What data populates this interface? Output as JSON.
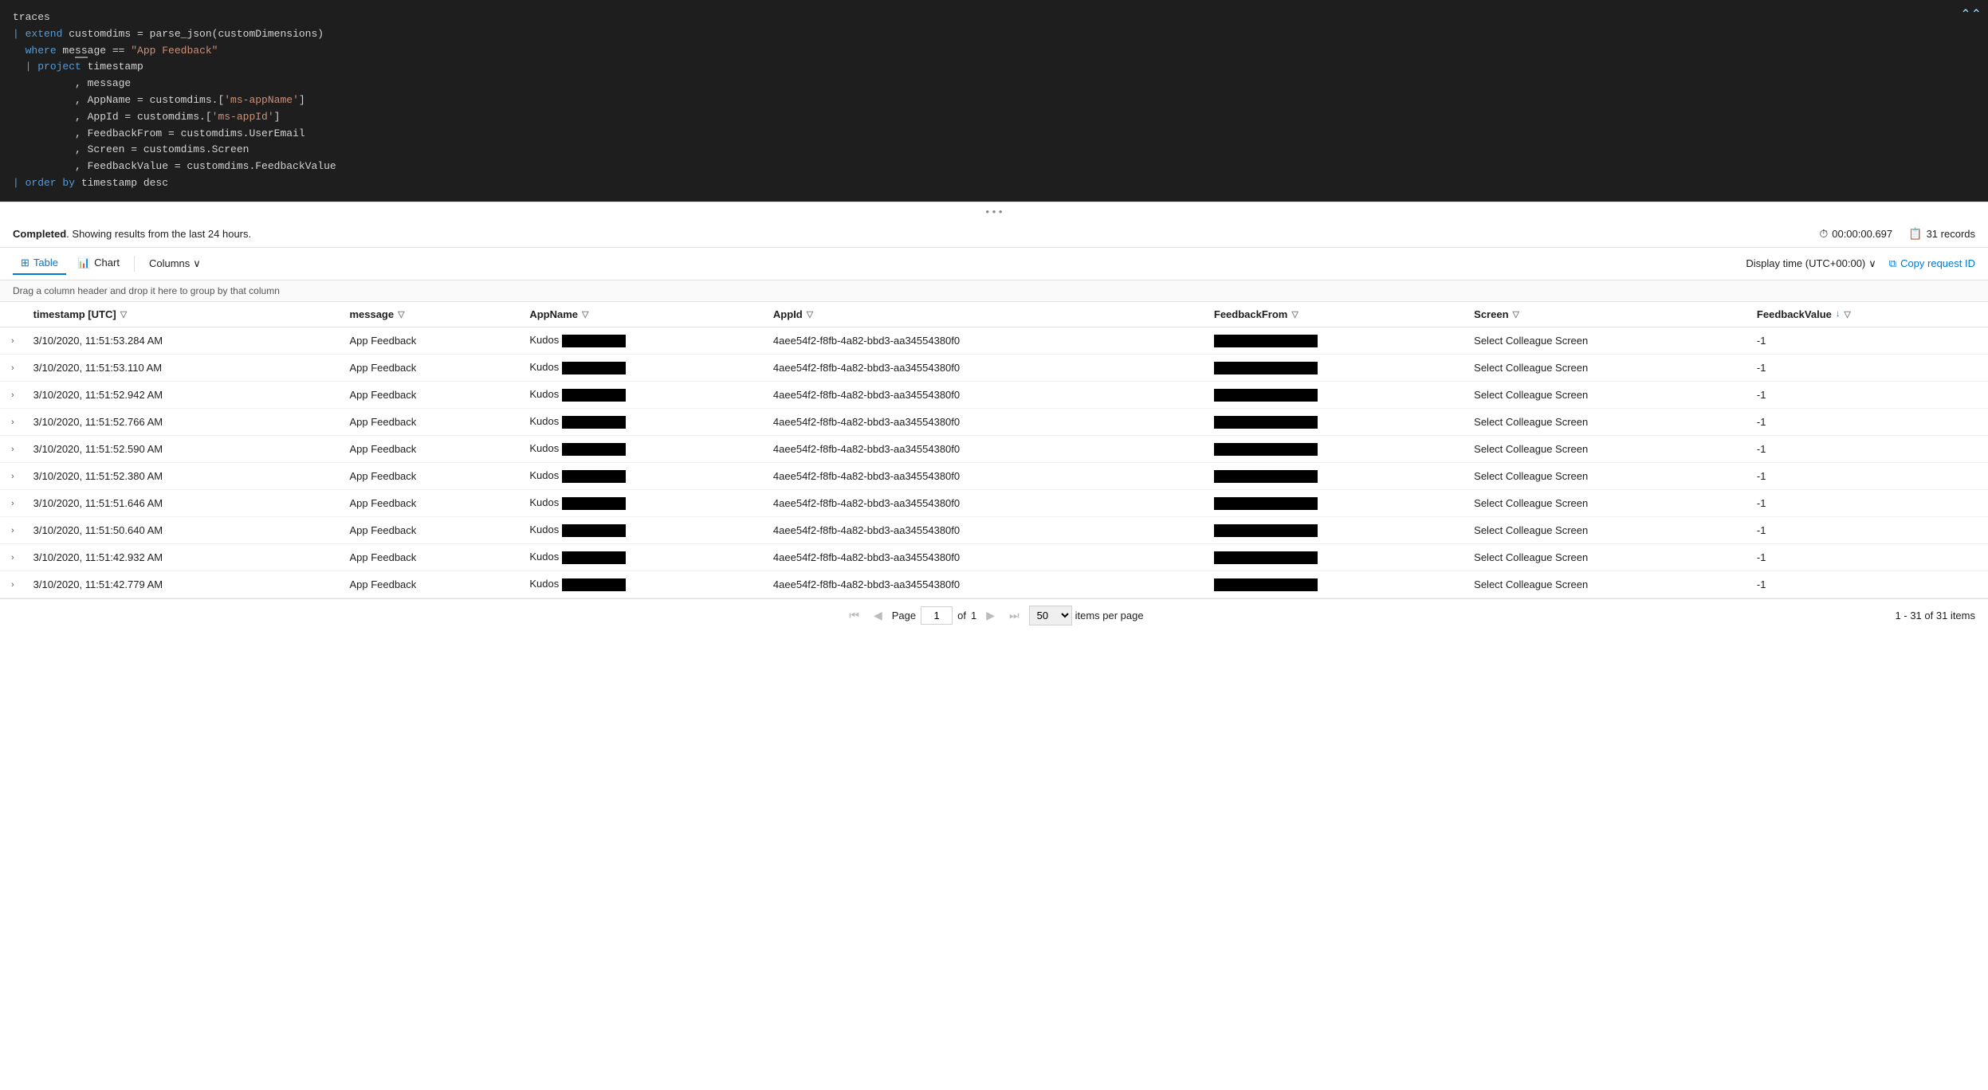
{
  "editor": {
    "lines": [
      {
        "text": "traces",
        "parts": [
          {
            "t": "plain",
            "v": "traces"
          }
        ]
      },
      {
        "text": "| extend customdims = parse_json(customDimensions)",
        "parts": [
          {
            "t": "kw",
            "v": "| extend"
          },
          {
            "t": "plain",
            "v": " customdims = parse_json(customDimensions)"
          }
        ]
      },
      {
        "text": "where message == \"App Feedback\"",
        "parts": [
          {
            "t": "kw",
            "v": "where"
          },
          {
            "t": "plain",
            "v": " message == "
          },
          {
            "t": "str",
            "v": "\"App Feedback\""
          }
        ]
      },
      {
        "text": "| project timestamp",
        "parts": [
          {
            "t": "kw",
            "v": "| project"
          },
          {
            "t": "plain",
            "v": " timestamp"
          }
        ]
      },
      {
        "text": "          , message",
        "parts": [
          {
            "t": "plain",
            "v": "          , message"
          }
        ]
      },
      {
        "text": "          , AppName = customdims.['ms-appName']",
        "parts": [
          {
            "t": "plain",
            "v": "          , AppName = customdims.["
          },
          {
            "t": "str",
            "v": "'ms-appName'"
          },
          {
            "t": "plain",
            "v": "]"
          }
        ]
      },
      {
        "text": "          , AppId = customdims.['ms-appId']",
        "parts": [
          {
            "t": "plain",
            "v": "          , AppId = customdims.["
          },
          {
            "t": "str",
            "v": "'ms-appId'"
          },
          {
            "t": "plain",
            "v": "]"
          }
        ]
      },
      {
        "text": "          , FeedbackFrom = customdims.UserEmail",
        "parts": [
          {
            "t": "plain",
            "v": "          , FeedbackFrom = customdims.UserEmail"
          }
        ]
      },
      {
        "text": "          , Screen = customdims.Screen",
        "parts": [
          {
            "t": "plain",
            "v": "          , Screen = customdims.Screen"
          }
        ]
      },
      {
        "text": "          , FeedbackValue = customdims.FeedbackValue",
        "parts": [
          {
            "t": "plain",
            "v": "          , FeedbackValue = customdims.FeedbackValue"
          }
        ]
      },
      {
        "text": "| order by timestamp desc",
        "parts": [
          {
            "t": "kw",
            "v": "| order by"
          },
          {
            "t": "plain",
            "v": " timestamp desc"
          }
        ]
      }
    ]
  },
  "status": {
    "completed_text": "Completed",
    "showing_text": ". Showing results from the last 24 hours.",
    "time_label": "00:00:00.697",
    "records_label": "31 records"
  },
  "toolbar": {
    "tab_table": "Table",
    "tab_chart": "Chart",
    "columns_label": "Columns",
    "display_time_label": "Display time (UTC+00:00)",
    "copy_request_label": "Copy request ID"
  },
  "hint": {
    "text": "Drag a column header and drop it here to group by that column"
  },
  "table": {
    "columns": [
      {
        "key": "expand",
        "label": ""
      },
      {
        "key": "timestamp",
        "label": "timestamp [UTC]",
        "filter": true
      },
      {
        "key": "message",
        "label": "message",
        "filter": true
      },
      {
        "key": "appname",
        "label": "AppName",
        "filter": true
      },
      {
        "key": "appid",
        "label": "AppId",
        "filter": true
      },
      {
        "key": "feedbackfrom",
        "label": "FeedbackFrom",
        "filter": true
      },
      {
        "key": "screen",
        "label": "Screen",
        "filter": true
      },
      {
        "key": "feedbackvalue",
        "label": "FeedbackValue",
        "filter": true,
        "sort": "desc"
      }
    ],
    "rows": [
      {
        "timestamp": "3/10/2020, 11:51:53.284 AM",
        "message": "App Feedback",
        "appname": "Kudos",
        "appid": "4aee54f2-f8fb-4a82-bbd3-aa34554380f0",
        "feedbackfrom": "REDACTED",
        "screen": "Select Colleague Screen",
        "feedbackvalue": "-1"
      },
      {
        "timestamp": "3/10/2020, 11:51:53.110 AM",
        "message": "App Feedback",
        "appname": "Kudos",
        "appid": "4aee54f2-f8fb-4a82-bbd3-aa34554380f0",
        "feedbackfrom": "REDACTED",
        "screen": "Select Colleague Screen",
        "feedbackvalue": "-1"
      },
      {
        "timestamp": "3/10/2020, 11:51:52.942 AM",
        "message": "App Feedback",
        "appname": "Kudos",
        "appid": "4aee54f2-f8fb-4a82-bbd3-aa34554380f0",
        "feedbackfrom": "REDACTED",
        "screen": "Select Colleague Screen",
        "feedbackvalue": "-1"
      },
      {
        "timestamp": "3/10/2020, 11:51:52.766 AM",
        "message": "App Feedback",
        "appname": "Kudos",
        "appid": "4aee54f2-f8fb-4a82-bbd3-aa34554380f0",
        "feedbackfrom": "REDACTED",
        "screen": "Select Colleague Screen",
        "feedbackvalue": "-1"
      },
      {
        "timestamp": "3/10/2020, 11:51:52.590 AM",
        "message": "App Feedback",
        "appname": "Kudos",
        "appid": "4aee54f2-f8fb-4a82-bbd3-aa34554380f0",
        "feedbackfrom": "REDACTED",
        "screen": "Select Colleague Screen",
        "feedbackvalue": "-1"
      },
      {
        "timestamp": "3/10/2020, 11:51:52.380 AM",
        "message": "App Feedback",
        "appname": "Kudos",
        "appid": "4aee54f2-f8fb-4a82-bbd3-aa34554380f0",
        "feedbackfrom": "REDACTED",
        "screen": "Select Colleague Screen",
        "feedbackvalue": "-1"
      },
      {
        "timestamp": "3/10/2020, 11:51:51.646 AM",
        "message": "App Feedback",
        "appname": "Kudos",
        "appid": "4aee54f2-f8fb-4a82-bbd3-aa34554380f0",
        "feedbackfrom": "REDACTED",
        "screen": "Select Colleague Screen",
        "feedbackvalue": "-1"
      },
      {
        "timestamp": "3/10/2020, 11:51:50.640 AM",
        "message": "App Feedback",
        "appname": "Kudos",
        "appid": "4aee54f2-f8fb-4a82-bbd3-aa34554380f0",
        "feedbackfrom": "REDACTED",
        "screen": "Select Colleague Screen",
        "feedbackvalue": "-1"
      },
      {
        "timestamp": "3/10/2020, 11:51:42.932 AM",
        "message": "App Feedback",
        "appname": "Kudos",
        "appid": "4aee54f2-f8fb-4a82-bbd3-aa34554380f0",
        "feedbackfrom": "REDACTED",
        "screen": "Select Colleague Screen",
        "feedbackvalue": "-1"
      },
      {
        "timestamp": "3/10/2020, 11:51:42.779 AM",
        "message": "App Feedback",
        "appname": "Kudos",
        "appid": "4aee54f2-f8fb-4a82-bbd3-aa34554380f0",
        "feedbackfrom": "REDACTED",
        "screen": "Select Colleague Screen",
        "feedbackvalue": "-1"
      }
    ]
  },
  "pagination": {
    "page_label": "Page",
    "current_page": "1",
    "of_label": "of",
    "total_pages": "1",
    "per_page_value": "50",
    "items_label": "items per page",
    "range_label": "1 - 31 of 31 items"
  }
}
